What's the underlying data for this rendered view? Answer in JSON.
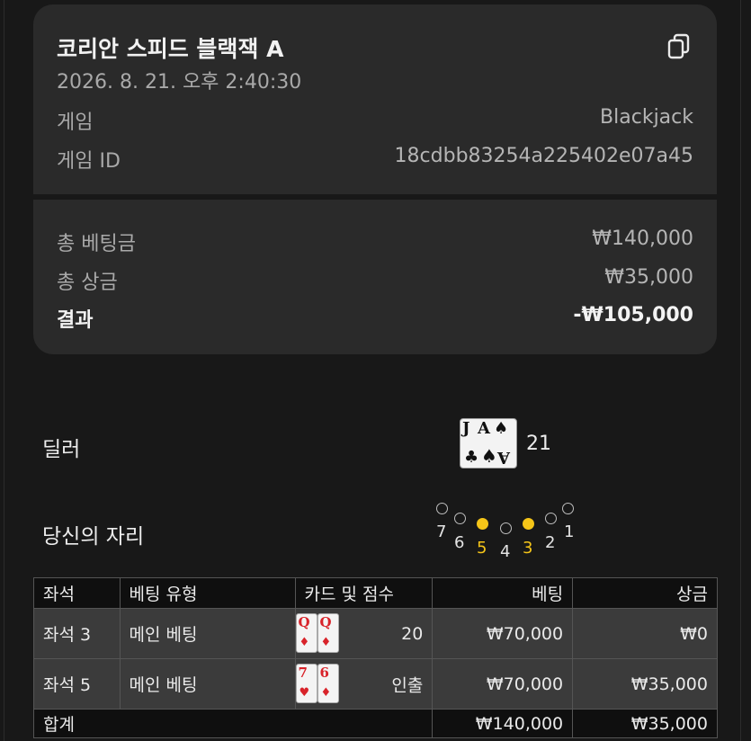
{
  "summary": {
    "title": "코리안 스피드 블랙잭 A",
    "datetime": "2026. 8. 21. 오후 2:40:30",
    "game_label": "게임",
    "game_value": "Blackjack",
    "game_id_label": "게임 ID",
    "game_id_value": "18cdbb83254a225402e07a45",
    "copy_icon": "copy-icon"
  },
  "totals": {
    "total_bet_label": "총 베팅금",
    "total_bet_value": "₩140,000",
    "total_win_label": "총 상금",
    "total_win_value": "₩35,000",
    "result_label": "결과",
    "result_value": "-₩105,000"
  },
  "dealer": {
    "label": "딜러",
    "cards": [
      {
        "rank": "J",
        "suit": "♣"
      },
      {
        "rank": "A",
        "suit": "♠"
      }
    ],
    "score": "21"
  },
  "seats": {
    "label": "당신의 자리",
    "numbers": [
      "7",
      "6",
      "5",
      "4",
      "3",
      "2",
      "1"
    ],
    "active": [
      "5",
      "3"
    ]
  },
  "bets_table": {
    "headers": [
      "좌석",
      "베팅 유형",
      "카드 및 점수",
      "베팅",
      "상금"
    ],
    "rows": [
      {
        "seat": "좌석 3",
        "type": "메인 베팅",
        "cards": [
          {
            "rank": "Q",
            "suit": "♦"
          },
          {
            "rank": "Q",
            "suit": "♦"
          }
        ],
        "score": "20",
        "bet": "₩70,000",
        "win": "₩0"
      },
      {
        "seat": "좌석 5",
        "type": "메인 베팅",
        "cards": [
          {
            "rank": "7",
            "suit": "♥"
          },
          {
            "rank": "6",
            "suit": "♦"
          }
        ],
        "score": "인출",
        "bet": "₩70,000",
        "win": "₩35,000"
      }
    ],
    "footer": {
      "label": "합계",
      "bet": "₩140,000",
      "win": "₩35,000"
    }
  }
}
